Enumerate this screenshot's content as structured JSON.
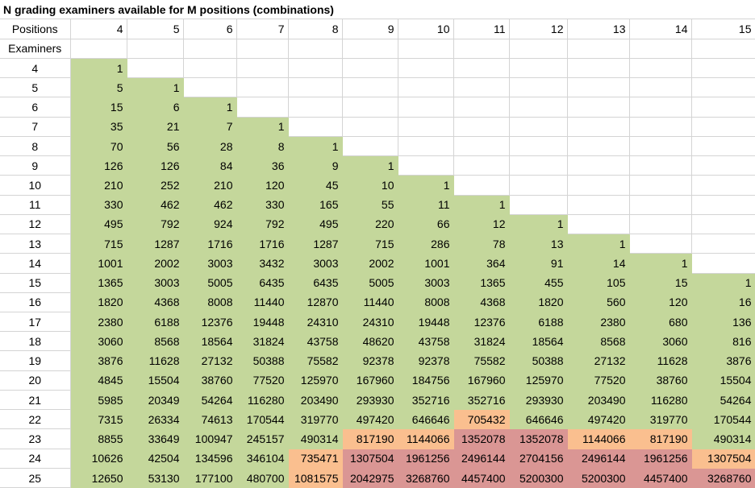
{
  "title": "N grading examiners available for M positions (combinations)",
  "positions_label": "Positions",
  "examiners_label": "Examiners",
  "positions": [
    4,
    5,
    6,
    7,
    8,
    9,
    10,
    11,
    12,
    13,
    14,
    15
  ],
  "colors": {
    "g": "#c4d79b",
    "o": "#fabf8f",
    "r": "#da9694"
  },
  "rows": [
    {
      "n": 4,
      "values": [
        1
      ],
      "fills": "g"
    },
    {
      "n": 5,
      "values": [
        5,
        1
      ],
      "fills": "gg"
    },
    {
      "n": 6,
      "values": [
        15,
        6,
        1
      ],
      "fills": "ggg"
    },
    {
      "n": 7,
      "values": [
        35,
        21,
        7,
        1
      ],
      "fills": "gggg"
    },
    {
      "n": 8,
      "values": [
        70,
        56,
        28,
        8,
        1
      ],
      "fills": "ggggg"
    },
    {
      "n": 9,
      "values": [
        126,
        126,
        84,
        36,
        9,
        1
      ],
      "fills": "gggggg"
    },
    {
      "n": 10,
      "values": [
        210,
        252,
        210,
        120,
        45,
        10,
        1
      ],
      "fills": "ggggggg"
    },
    {
      "n": 11,
      "values": [
        330,
        462,
        462,
        330,
        165,
        55,
        11,
        1
      ],
      "fills": "gggggggg"
    },
    {
      "n": 12,
      "values": [
        495,
        792,
        924,
        792,
        495,
        220,
        66,
        12,
        1
      ],
      "fills": "ggggggggg"
    },
    {
      "n": 13,
      "values": [
        715,
        1287,
        1716,
        1716,
        1287,
        715,
        286,
        78,
        13,
        1
      ],
      "fills": "gggggggggg"
    },
    {
      "n": 14,
      "values": [
        1001,
        2002,
        3003,
        3432,
        3003,
        2002,
        1001,
        364,
        91,
        14,
        1
      ],
      "fills": "ggggggggggg"
    },
    {
      "n": 15,
      "values": [
        1365,
        3003,
        5005,
        6435,
        6435,
        5005,
        3003,
        1365,
        455,
        105,
        15,
        1
      ],
      "fills": "gggggggggggg"
    },
    {
      "n": 16,
      "values": [
        1820,
        4368,
        8008,
        11440,
        12870,
        11440,
        8008,
        4368,
        1820,
        560,
        120,
        16
      ],
      "fills": "gggggggggggg"
    },
    {
      "n": 17,
      "values": [
        2380,
        6188,
        12376,
        19448,
        24310,
        24310,
        19448,
        12376,
        6188,
        2380,
        680,
        136
      ],
      "fills": "gggggggggggg"
    },
    {
      "n": 18,
      "values": [
        3060,
        8568,
        18564,
        31824,
        43758,
        48620,
        43758,
        31824,
        18564,
        8568,
        3060,
        816
      ],
      "fills": "gggggggggggg"
    },
    {
      "n": 19,
      "values": [
        3876,
        11628,
        27132,
        50388,
        75582,
        92378,
        92378,
        75582,
        50388,
        27132,
        11628,
        3876
      ],
      "fills": "gggggggggggg"
    },
    {
      "n": 20,
      "values": [
        4845,
        15504,
        38760,
        77520,
        125970,
        167960,
        184756,
        167960,
        125970,
        77520,
        38760,
        15504
      ],
      "fills": "gggggggggggg"
    },
    {
      "n": 21,
      "values": [
        5985,
        20349,
        54264,
        116280,
        203490,
        293930,
        352716,
        352716,
        293930,
        203490,
        116280,
        54264
      ],
      "fills": "gggggggggggg"
    },
    {
      "n": 22,
      "values": [
        7315,
        26334,
        74613,
        170544,
        319770,
        497420,
        646646,
        705432,
        646646,
        497420,
        319770,
        170544
      ],
      "fills": "gggggggogggg"
    },
    {
      "n": 23,
      "values": [
        8855,
        33649,
        100947,
        245157,
        490314,
        817190,
        1144066,
        1352078,
        1352078,
        1144066,
        817190,
        490314
      ],
      "fills": "gggggoorroog"
    },
    {
      "n": 24,
      "values": [
        10626,
        42504,
        134596,
        346104,
        735471,
        1307504,
        1961256,
        2496144,
        2704156,
        2496144,
        1961256,
        1307504
      ],
      "fills": "ggggorrrrrro"
    },
    {
      "n": 25,
      "values": [
        12650,
        53130,
        177100,
        480700,
        1081575,
        2042975,
        3268760,
        4457400,
        5200300,
        5200300,
        4457400,
        3268760
      ],
      "fills": "ggggorrrrrrr"
    }
  ]
}
